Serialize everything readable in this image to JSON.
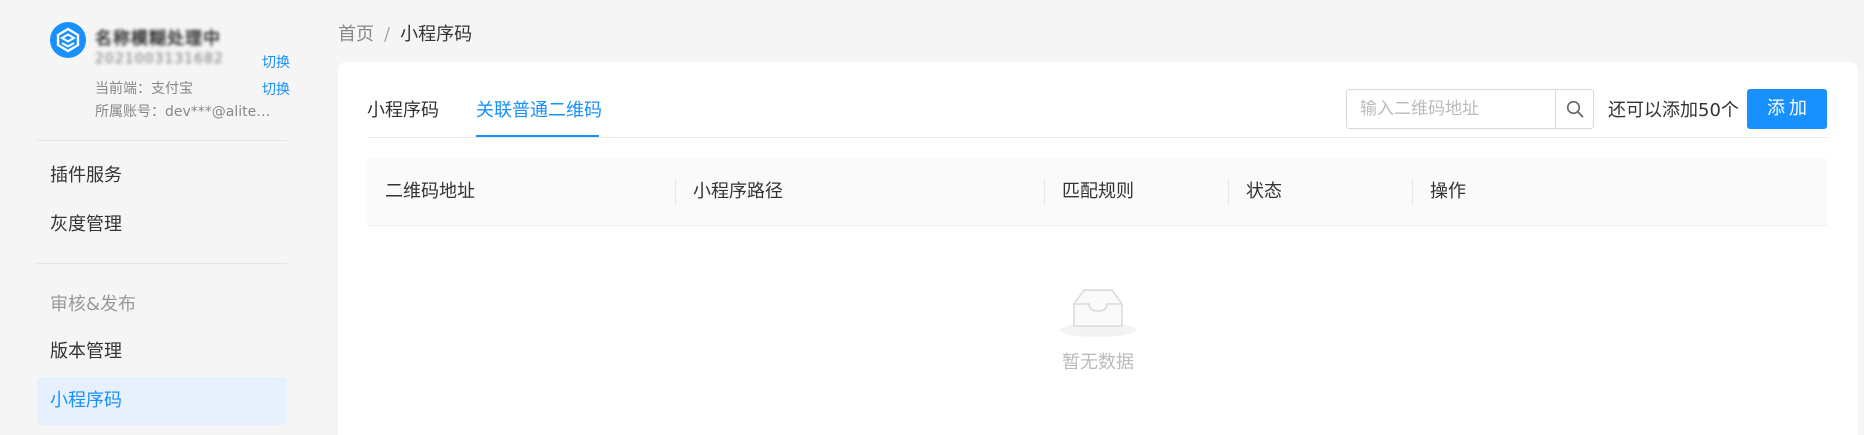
{
  "app": {
    "name": "名称模糊处理中",
    "id": "2021003131682",
    "switch_label": "切换",
    "platform_line": "当前端：支付宝",
    "account_line": "所属账号：dev***@alitest.com"
  },
  "sidebar": {
    "items_top": [
      {
        "label": "插件服务"
      },
      {
        "label": "灰度管理"
      }
    ],
    "group_title": "审核&发布",
    "items_group": [
      {
        "label": "版本管理"
      },
      {
        "label": "小程序码"
      }
    ]
  },
  "breadcrumb": {
    "home": "首页",
    "separator": "/",
    "current": "小程序码"
  },
  "tabs": [
    {
      "label": "小程序码",
      "active": false
    },
    {
      "label": "关联普通二维码",
      "active": true
    }
  ],
  "search": {
    "placeholder": "输入二维码地址",
    "value": ""
  },
  "remain_text": "还可以添加50个",
  "add_button_label": "添加",
  "table": {
    "columns": [
      "二维码地址",
      "小程序路径",
      "匹配规则",
      "状态",
      "操作"
    ],
    "rows": []
  },
  "empty_text": "暂无数据",
  "colors": {
    "accent": "#1890ff",
    "active_bg": "#e6f1fd"
  }
}
